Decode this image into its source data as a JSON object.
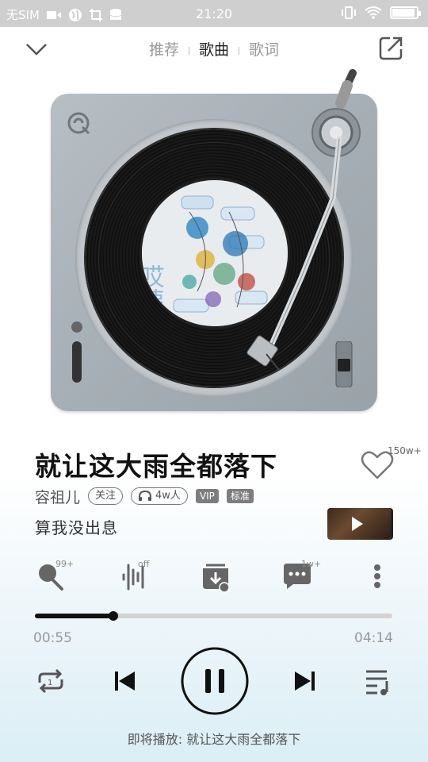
{
  "status_bar": {
    "carrier": "无SIM",
    "time": "21:20",
    "battery_level": 0.95
  },
  "top_nav": {
    "tabs": [
      {
        "label": "推荐",
        "active": false
      },
      {
        "label": "歌曲",
        "active": true
      },
      {
        "label": "歌词",
        "active": false
      }
    ],
    "icons": {
      "collapse": "chevron-down-icon",
      "share": "share-icon"
    }
  },
  "player": {
    "song_title": "就让这大雨全都落下",
    "like_count": "150w+",
    "artist": "容祖儿",
    "follow_label": "关注",
    "listeners": "4w人",
    "vip_tag": "VIP",
    "quality_tag": "标准",
    "current_lyric": "算我没出息",
    "album_art_text": "哎咦"
  },
  "actions": [
    {
      "name": "sing-icon",
      "count": "99+"
    },
    {
      "name": "sound-effect-icon",
      "count": "off"
    },
    {
      "name": "download-icon",
      "count": ""
    },
    {
      "name": "comment-icon",
      "count": "1w+"
    },
    {
      "name": "more-icon",
      "count": ""
    }
  ],
  "progress": {
    "current": "00:55",
    "total": "04:14",
    "fraction": 0.22
  },
  "controls": {
    "repeat": "repeat-icon",
    "prev": "previous-icon",
    "play_pause": "pause-icon",
    "next": "next-icon",
    "playlist": "playlist-icon"
  },
  "next_up": "即将播放: 就让这大雨全都落下",
  "colors": {
    "status_bar": "#cfcfcf",
    "turntable": "#a8b0b7",
    "progress_fill": "#111111",
    "progress_track": "#d3d3d3"
  }
}
